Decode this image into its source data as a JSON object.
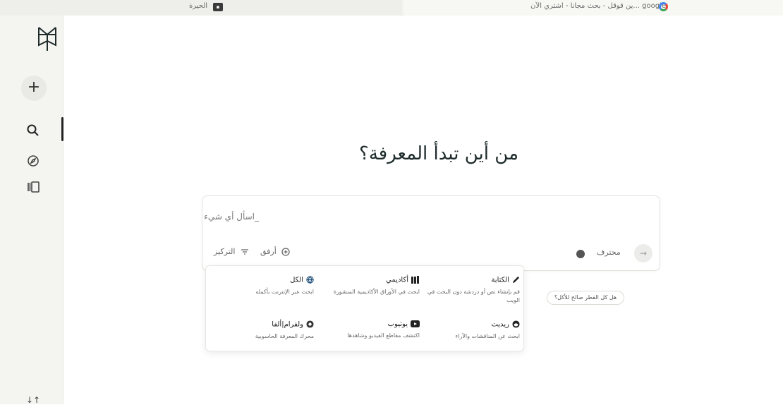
{
  "browser": {
    "tab_left_title": "الحيرة",
    "tab_right_title": "google ...ين قوقل - بحث مجانا - اشتري الآن"
  },
  "sidebar": {
    "new_label": "+",
    "bottom_label": "↓↑"
  },
  "main": {
    "headline": "من أين تبدأ المعرفة؟"
  },
  "search": {
    "placeholder": "_اسأل أي شيء",
    "focus_label": "التركيز",
    "attach_label": "أرفق",
    "pro_label": "محترف",
    "submit_icon": "→"
  },
  "focus_menu": {
    "options": [
      {
        "title": "الكل",
        "desc": "ابحث عبر الإنترنت بأكمله",
        "icon": "globe-icon"
      },
      {
        "title": "أكاديمي",
        "desc": "ابحث في الأوراق الأكاديمية المنشورة",
        "icon": "books-icon"
      },
      {
        "title": "الكتابة",
        "desc": "قم بإنشاء نص أو دردشة دون البحث في الويب",
        "icon": "pen-icon"
      },
      {
        "title": "ولفرام|ألفا",
        "desc": "محرك المعرفة الحاسوبية",
        "icon": "wolfram-icon"
      },
      {
        "title": "يوتيوب",
        "desc": "اكتشف مقاطع الفيديو وشاهدها",
        "icon": "youtube-icon"
      },
      {
        "title": "ريديت",
        "desc": "ابحث عن المناقشات والآراء",
        "icon": "reddit-icon"
      }
    ]
  },
  "suggestion": {
    "text": "هل كل القطر صالح للأكل؟"
  },
  "colors": {
    "sidebar_bg": "#f4f4f1",
    "text": "#1f2b2b",
    "accent_dark": "#222222"
  }
}
